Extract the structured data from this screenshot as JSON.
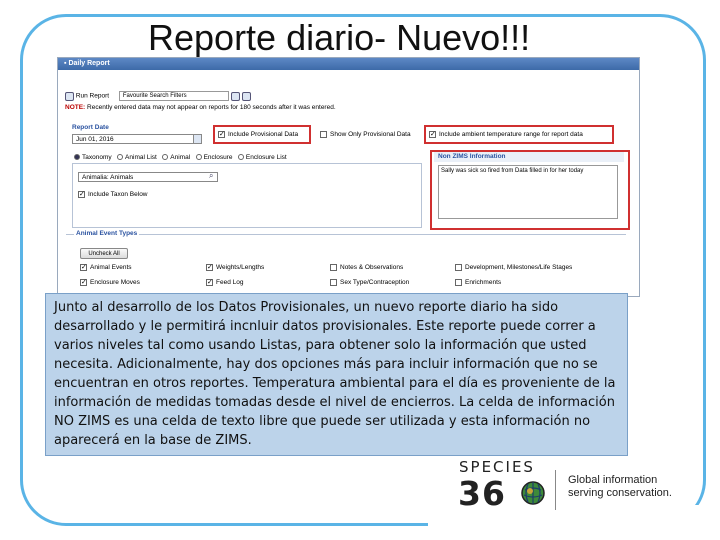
{
  "slide": {
    "title": "Reporte diario- Nuevo!!!",
    "overlay_text": "Junto al desarrollo de los Datos Provisionales, un nuevo reporte diario ha sido desarrollado y le permitirá incnluir datos provisionales. Este reporte puede correr a varios niveles tal como usando Listas, para obtener solo la información que usted necesita. Adicionalmente, hay dos opciones más para incluir información que no se encuentran en otros reportes. Temperatura ambiental para el día es proveniente de la información de medidas tomadas desde el nivel de encierros. La celda de información NO ZIMS es una celda de texto libre que puede ser utilizada y esta información no aparecerá en la base de ZIMS."
  },
  "screenshot": {
    "window_title": "Daily Report",
    "run_report": "Run Report",
    "saved_filter": "Favourite Search Filters",
    "note_label": "NOTE:",
    "note_text": "Recently entered data may not appear on reports for 180 seconds after it was entered.",
    "report_date_label": "Report Date",
    "report_date_value": "Jun 01, 2016",
    "include_provisional": "Include Provisional Data",
    "show_only_provisional": "Show Only Provisional Data",
    "include_ambient": "Include ambient temperature range for report data",
    "tabs": [
      "Taxonomy",
      "Animal List",
      "Animal",
      "Enclosure",
      "Enclosure List"
    ],
    "taxonomy_value": "Animalia: Animals",
    "include_taxon_below": "Include Taxon Below",
    "non_zims_label": "Non ZIMS Information",
    "non_zims_text": "Sally was sick so fired from Data filled in for her today",
    "animal_event_types": "Animal Event Types",
    "uncheck_all": "Uncheck All",
    "events_row1": [
      "Animal Events",
      "Weights/Lengths",
      "Notes & Observations",
      "Development, Milestones/Life Stages"
    ],
    "events_row2": [
      "Enclosure Moves",
      "Feed Log",
      "Sex Type/Contraception",
      "Enrichments"
    ]
  },
  "logo": {
    "word": "SPECIES",
    "number_left": "36",
    "tagline_1": "Global information",
    "tagline_2": "serving conservation."
  },
  "colors": {
    "frame": "#5ab4e6",
    "overlay_bg": "#bcd3ea",
    "highlight_red": "#d03030",
    "link_blue": "#2a52a0"
  }
}
